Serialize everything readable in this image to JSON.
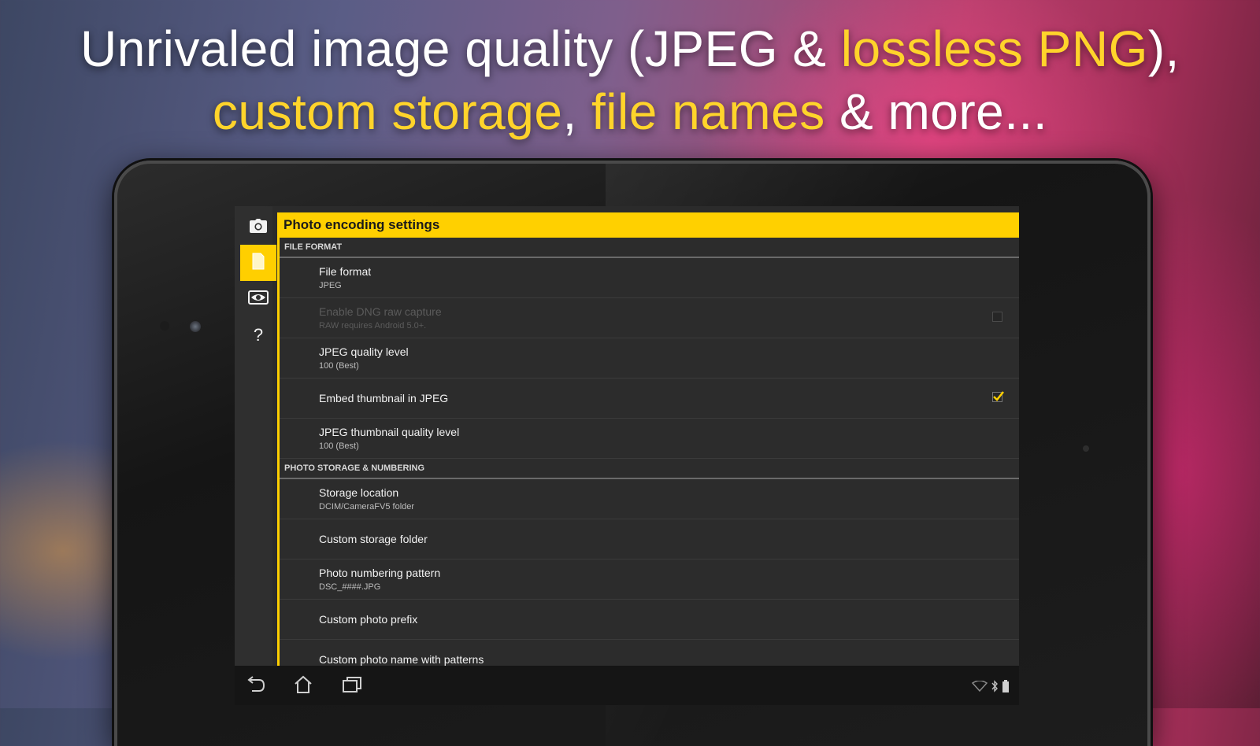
{
  "headline": {
    "line1_a": "Unrivaled image quality (JPEG & ",
    "line1_b": "lossless PNG",
    "line1_c": "),",
    "line2_a": "custom storage",
    "line2_b": ", ",
    "line2_c": "file names",
    "line2_d": " & more..."
  },
  "colors": {
    "accent": "#ffd000",
    "headline_highlight": "#ffd42b",
    "background": "#2c2c2c"
  },
  "sidebar": {
    "items": [
      {
        "icon": "camera-icon",
        "active": false
      },
      {
        "icon": "document-icon",
        "active": true
      },
      {
        "icon": "eye-icon",
        "active": false
      },
      {
        "icon": "help-icon",
        "label": "?",
        "active": false
      }
    ]
  },
  "settings": {
    "title": "Photo encoding settings",
    "sections": [
      {
        "header": "FILE FORMAT",
        "items": [
          {
            "title": "File format",
            "summary": "JPEG"
          },
          {
            "title": "Enable DNG raw capture",
            "summary": "RAW requires Android 5.0+.",
            "checkbox": false,
            "disabled": true
          },
          {
            "title": "JPEG quality level",
            "summary": "100 (Best)"
          },
          {
            "title": "Embed thumbnail in JPEG",
            "checkbox": true
          },
          {
            "title": "JPEG thumbnail quality level",
            "summary": "100 (Best)"
          }
        ]
      },
      {
        "header": "PHOTO STORAGE & NUMBERING",
        "items": [
          {
            "title": "Storage location",
            "summary": "DCIM/CameraFV5 folder"
          },
          {
            "title": "Custom storage folder"
          },
          {
            "title": "Photo numbering pattern",
            "summary": "DSC_####.JPG"
          },
          {
            "title": "Custom photo prefix"
          },
          {
            "title": "Custom photo name with patterns"
          }
        ]
      }
    ]
  },
  "navbar": {
    "buttons": [
      "back-icon",
      "home-icon",
      "recents-icon"
    ],
    "status_icons": [
      "wifi-icon",
      "bluetooth-icon",
      "battery-icon"
    ]
  }
}
